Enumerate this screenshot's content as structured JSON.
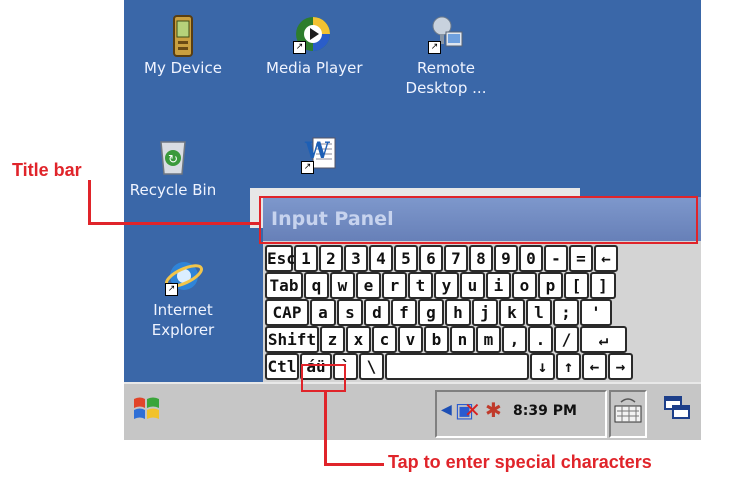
{
  "desktop": {
    "icons": [
      {
        "label": "My Device",
        "icon": "my-device-icon"
      },
      {
        "label": "Media Player",
        "icon": "media-player-icon"
      },
      {
        "label": "Remote\nDesktop ...",
        "icon": "remote-desktop-icon"
      },
      {
        "label": "Recycle Bin",
        "icon": "recycle-bin-icon"
      },
      {
        "label": "",
        "icon": "wordpad-icon"
      },
      {
        "label": "Internet\nExplorer",
        "icon": "internet-explorer-icon"
      }
    ]
  },
  "input_panel": {
    "title": "Input Panel",
    "rows": [
      [
        "Esc",
        "1",
        "2",
        "3",
        "4",
        "5",
        "6",
        "7",
        "8",
        "9",
        "0",
        "-",
        "=",
        "←"
      ],
      [
        "Tab",
        "q",
        "w",
        "e",
        "r",
        "t",
        "y",
        "u",
        "i",
        "o",
        "p",
        "[",
        "]"
      ],
      [
        "CAP",
        "a",
        "s",
        "d",
        "f",
        "g",
        "h",
        "j",
        "k",
        "l",
        ";",
        "'"
      ],
      [
        "Shift",
        "z",
        "x",
        "c",
        "v",
        "b",
        "n",
        "m",
        ",",
        ".",
        "/",
        "↵"
      ],
      [
        "Ctl",
        "áü",
        "`",
        "\\",
        "",
        "↓",
        "↑",
        "←",
        "→"
      ]
    ]
  },
  "taskbar": {
    "start_icon": "windows-flag-icon",
    "time": "8:39 PM",
    "tray_icons": [
      "volume-icon",
      "network-disconnected-icon",
      "connection-icon"
    ],
    "keyboard_icon": "keyboard-icon",
    "desktop_icon": "show-desktop-icon"
  },
  "annotations": {
    "title_bar": "Title bar",
    "special_chars": "Tap to enter special characters"
  },
  "colors": {
    "desktop": "#3a67a8",
    "callout": "#e0242a",
    "title_bar": "#7289c4"
  }
}
